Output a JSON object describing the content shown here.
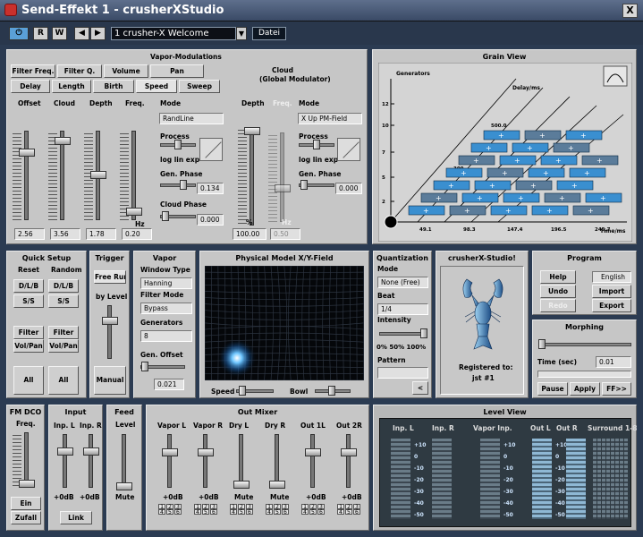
{
  "window": {
    "title": "Send-Effekt 1 - crusherXStudio",
    "close": "X"
  },
  "toolbar": {
    "r": "R",
    "w": "W",
    "prev": "◀",
    "next": "▶",
    "preset": "1 crusher-X Welcome",
    "menu": "Datei",
    "dd": "▼",
    "power": "⏻"
  },
  "vapor": {
    "title": "Vapor-Modulations",
    "row1": [
      "Filter Freq.",
      "Filter Q.",
      "Volume",
      "Pan"
    ],
    "row2": [
      "Delay",
      "Length",
      "Birth",
      "Speed",
      "Sweep"
    ],
    "sliders": [
      {
        "label": "Offset",
        "value": "2.56"
      },
      {
        "label": "Cloud",
        "value": "3.56"
      },
      {
        "label": "Depth",
        "value": "1.78"
      },
      {
        "label": "Freq.",
        "value": "0.20",
        "unit": "Hz"
      }
    ],
    "mode_label": "Mode",
    "mode_value": "RandLine",
    "process": "Process",
    "lle": "log  lin  exp",
    "gen_phase": "Gen. Phase",
    "gen_phase_value": "0.134",
    "cloud_phase": "Cloud Phase",
    "cloud_phase_value": "0.000"
  },
  "cloud": {
    "title": "Cloud",
    "subtitle": "(Global Modulator)",
    "depth": "Depth",
    "freq": "Freq.",
    "depth_value": "100.00",
    "freq_value": "0.50",
    "depth_unit": "%",
    "freq_unit": "Hz",
    "mode_label": "Mode",
    "mode_value": "X Up PM-Field",
    "process": "Process",
    "lle": "log  lin  exp",
    "gen_phase": "Gen. Phase",
    "gen_phase_value": "0.000"
  },
  "grain": {
    "title": "Grain View",
    "y_label": "Generators",
    "delay_label": "Delay/ms",
    "x_label": "Time/ms",
    "y_ticks": [
      "12",
      "10",
      "7",
      "5",
      "2"
    ],
    "x_ticks": [
      "49.1",
      "98.3",
      "147.4",
      "196.5",
      "245.7"
    ],
    "diag_ticks": [
      "500.0",
      "400.0",
      "300"
    ]
  },
  "quick": {
    "title": "Quick Setup",
    "reset": "Reset",
    "random": "Random",
    "dlb": "D/L/B",
    "ss": "S/S",
    "filter": "Filter",
    "volpan": "Vol/Pan",
    "all": "All"
  },
  "trigger": {
    "title": "Trigger",
    "freerun": "Free Run",
    "bylevel": "by Level",
    "manual": "Manual"
  },
  "vapor2": {
    "title": "Vapor",
    "window_type": "Window Type",
    "window_value": "Hanning",
    "filter_mode": "Filter Mode",
    "filter_value": "Bypass",
    "generators": "Generators",
    "generators_value": "8",
    "gen_offset": "Gen. Offset",
    "gen_offset_value": "0.021"
  },
  "physical": {
    "title": "Physical Model X/Y-Field",
    "speed": "Speed",
    "bowl": "Bowl"
  },
  "quant": {
    "title": "Quantization",
    "mode": "Mode",
    "mode_value": "None (Free)",
    "beat": "Beat",
    "beat_value": "1/4",
    "intensity": "Intensity",
    "int_ticks": "0%   50%  100%",
    "pattern": "Pattern",
    "back": "<"
  },
  "studio": {
    "title": "crusherX-Studio!",
    "reg": "Registered to:",
    "user": "jst #1"
  },
  "program": {
    "title": "Program",
    "help": "Help",
    "english": "English",
    "undo": "Undo",
    "import": "Import",
    "redo": "Redo",
    "export": "Export"
  },
  "morph": {
    "title": "Morphing",
    "time": "Time (sec)",
    "time_value": "0.01",
    "pause": "Pause",
    "apply": "Apply",
    "ff": "FF>>"
  },
  "fm": {
    "title": "FM DCO",
    "freq": "Freq.",
    "ein": "Ein",
    "zufall": "Zufall"
  },
  "input": {
    "title": "Input",
    "inpl": "Inp. L",
    "inpr": "Inp. R",
    "db": "+0dB",
    "link": "Link"
  },
  "feed": {
    "title": "Feed",
    "level": "Level",
    "mute": "Mute"
  },
  "outmix": {
    "title": "Out Mixer",
    "ch": [
      {
        "label": "Vapor L",
        "bottom": "+0dB",
        "matrix": true
      },
      {
        "label": "Vapor R",
        "bottom": "+0dB",
        "matrix": true
      },
      {
        "label": "Dry L",
        "bottom": "Mute",
        "matrix": true
      },
      {
        "label": "Dry R",
        "bottom": "Mute",
        "matrix": true
      },
      {
        "label": "Out 1L",
        "bottom": "+0dB",
        "matrix": true
      },
      {
        "label": "Out 2R",
        "bottom": "+0dB",
        "matrix": true
      }
    ]
  },
  "level": {
    "title": "Level View",
    "cols": [
      "Inp. L",
      "Inp. R",
      "Vapor Inp.",
      "Out L",
      "Out R",
      "Surround 1-8"
    ],
    "scale": [
      "+10",
      "0",
      "-10",
      "-20",
      "-30",
      "-40",
      "-50"
    ]
  },
  "colors": {
    "accent": "#3a8fd0",
    "panel": "#c6c6c6",
    "frame": "#2b3b52"
  }
}
